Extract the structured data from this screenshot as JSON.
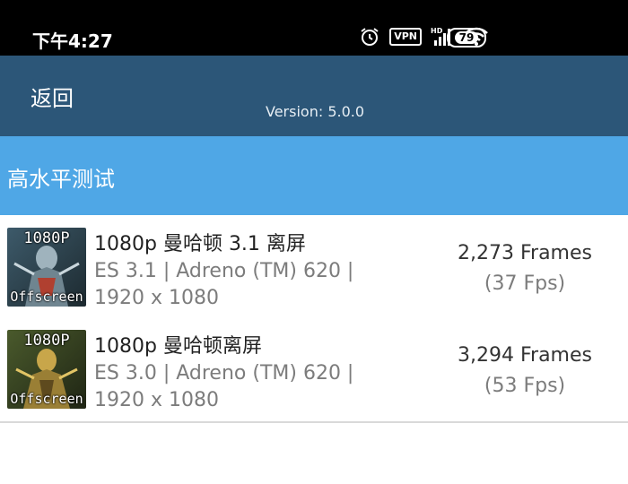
{
  "status_bar": {
    "time": "下午4:27",
    "icons": [
      "alarm-icon",
      "vpn-icon",
      "hd-signal-icon",
      "wifi-icon",
      "battery-icon"
    ],
    "vpn_label": "VPN",
    "battery": "79"
  },
  "app_bar": {
    "back_label": "返回",
    "version": "Version: 5.0.0"
  },
  "section": {
    "title": "高水平测试"
  },
  "results": [
    {
      "thumb_top": "1080P",
      "thumb_bottom": "Offscreen",
      "name": "1080p 曼哈顿 3.1 离屏",
      "detail": "ES 3.1 | Adreno (TM) 620 | 1920 x 1080",
      "score": "2,273 Frames",
      "fps": "(37 Fps)"
    },
    {
      "thumb_top": "1080P",
      "thumb_bottom": "Offscreen",
      "name": "1080p 曼哈顿离屏",
      "detail": "ES 3.0 | Adreno (TM) 620 | 1920 x 1080",
      "score": "3,294 Frames",
      "fps": "(53 Fps)"
    }
  ],
  "colors": {
    "app_bar": "#2c5678",
    "section_header": "#4fa7e6",
    "status_bar": "#000000"
  }
}
